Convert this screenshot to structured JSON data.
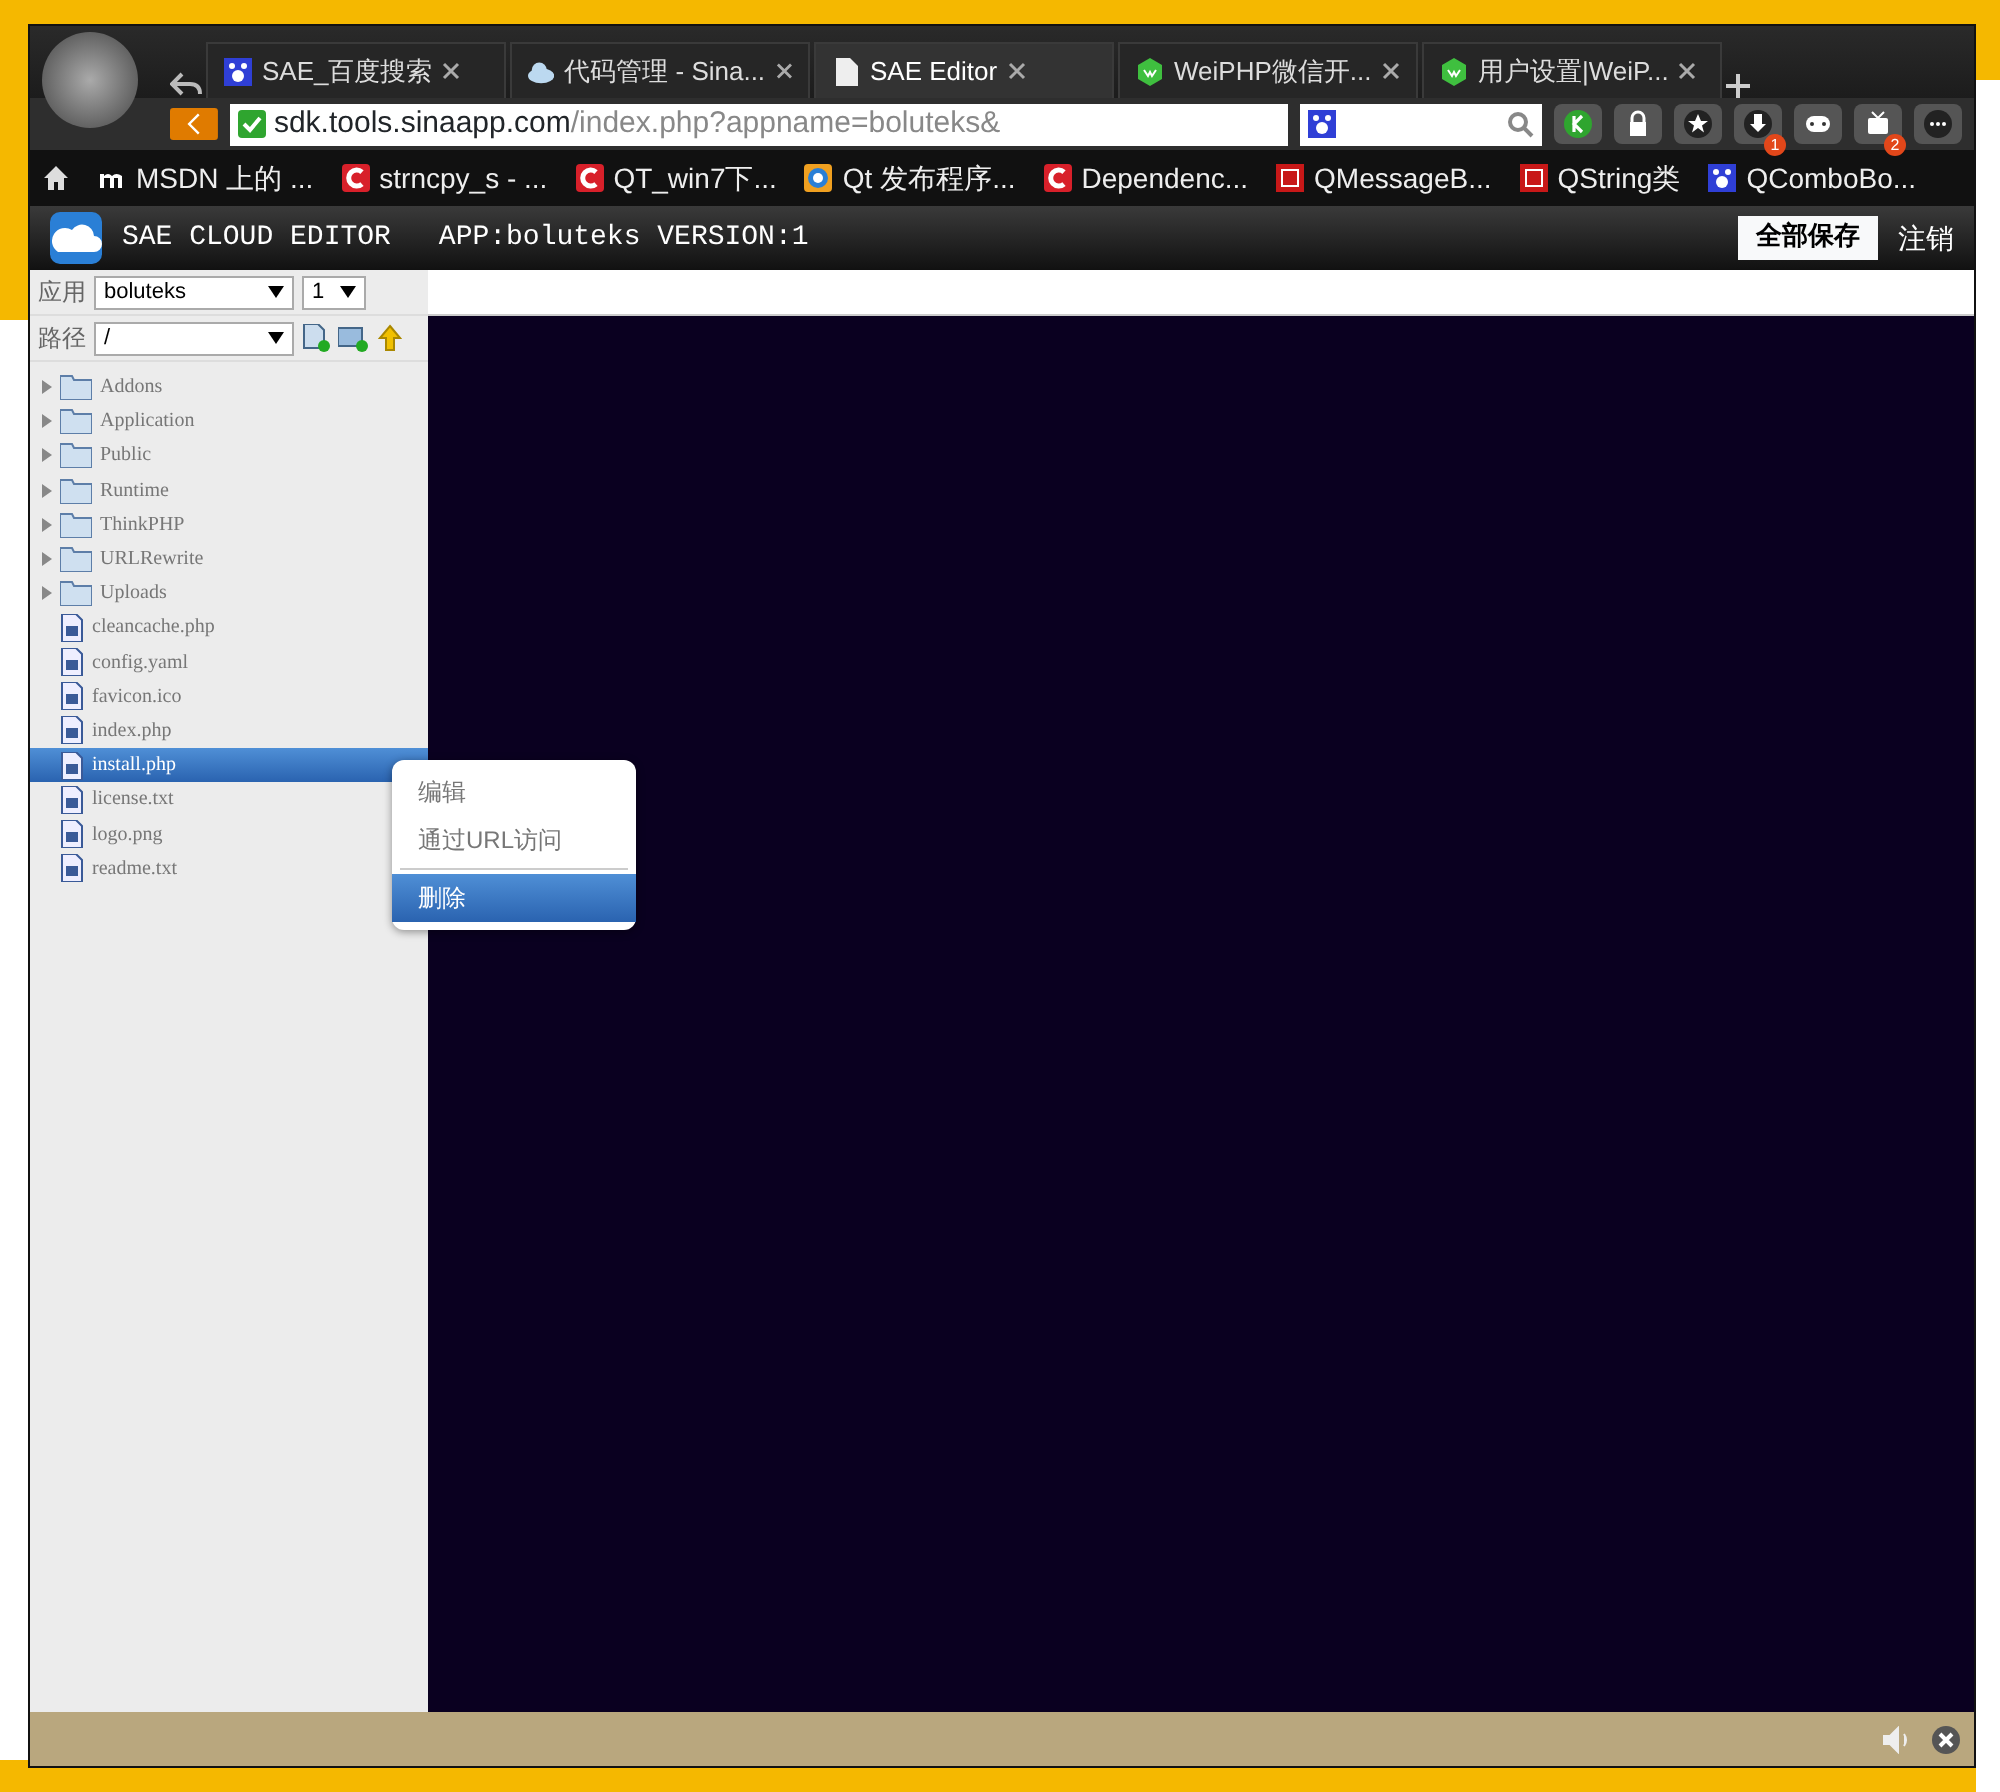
{
  "browser": {
    "tabs": [
      {
        "label": "SAE_百度搜索",
        "kind": "paw",
        "selected": false
      },
      {
        "label": "代码管理 - Sina...",
        "kind": "cloud",
        "selected": false
      },
      {
        "label": "SAE Editor",
        "kind": "page",
        "selected": true
      },
      {
        "label": "WeiPHP微信开...",
        "kind": "hex",
        "selected": false
      },
      {
        "label": "用户设置|WeiP...",
        "kind": "hex",
        "selected": false
      }
    ],
    "address": {
      "host": "sdk.tools.sinaapp.com",
      "path": "/index.php?appname=boluteks&"
    },
    "toolbar": [
      {
        "kind": "k"
      },
      {
        "kind": "lock"
      },
      {
        "kind": "star"
      },
      {
        "kind": "download",
        "badge": "1"
      },
      {
        "kind": "game"
      },
      {
        "kind": "tv",
        "badge": "2"
      },
      {
        "kind": "more"
      }
    ],
    "bookmarks": [
      {
        "label": "MSDN 上的 ...",
        "kind": "m"
      },
      {
        "label": "strncpy_s - ...",
        "kind": "c"
      },
      {
        "label": "QT_win7下...",
        "kind": "c"
      },
      {
        "label": "Qt 发布程序...",
        "kind": "q"
      },
      {
        "label": "Dependenc...",
        "kind": "c"
      },
      {
        "label": "QMessageB...",
        "kind": "ku"
      },
      {
        "label": "QString类",
        "kind": "ku"
      },
      {
        "label": "QComboBo...",
        "kind": "paw"
      }
    ]
  },
  "editor": {
    "title": "SAE CLOUD EDITOR",
    "app_info": "APP:boluteks VERSION:1",
    "save_all": "全部保存",
    "logout": "注销",
    "app_label": "应用",
    "app_value": "boluteks",
    "version_value": "1",
    "path_label": "路径",
    "path_value": "/",
    "files": [
      {
        "name": "Addons",
        "kind": "folder",
        "selected": false
      },
      {
        "name": "Application",
        "kind": "folder",
        "selected": false
      },
      {
        "name": "Public",
        "kind": "folder",
        "selected": false
      },
      {
        "name": "Runtime",
        "kind": "folder",
        "selected": false
      },
      {
        "name": "ThinkPHP",
        "kind": "folder",
        "selected": false
      },
      {
        "name": "URLRewrite",
        "kind": "folder",
        "selected": false
      },
      {
        "name": "Uploads",
        "kind": "folder",
        "selected": false
      },
      {
        "name": "cleancache.php",
        "kind": "file",
        "selected": false
      },
      {
        "name": "config.yaml",
        "kind": "file",
        "selected": false
      },
      {
        "name": "favicon.ico",
        "kind": "file",
        "selected": false
      },
      {
        "name": "index.php",
        "kind": "file",
        "selected": false
      },
      {
        "name": "install.php",
        "kind": "file",
        "selected": true
      },
      {
        "name": "license.txt",
        "kind": "file",
        "selected": false
      },
      {
        "name": "logo.png",
        "kind": "file",
        "selected": false
      },
      {
        "name": "readme.txt",
        "kind": "file",
        "selected": false
      }
    ],
    "context_menu": [
      {
        "label": "编辑",
        "selected": false
      },
      {
        "label": "通过URL访问",
        "selected": false
      },
      {
        "label": "删除",
        "selected": true
      }
    ]
  }
}
